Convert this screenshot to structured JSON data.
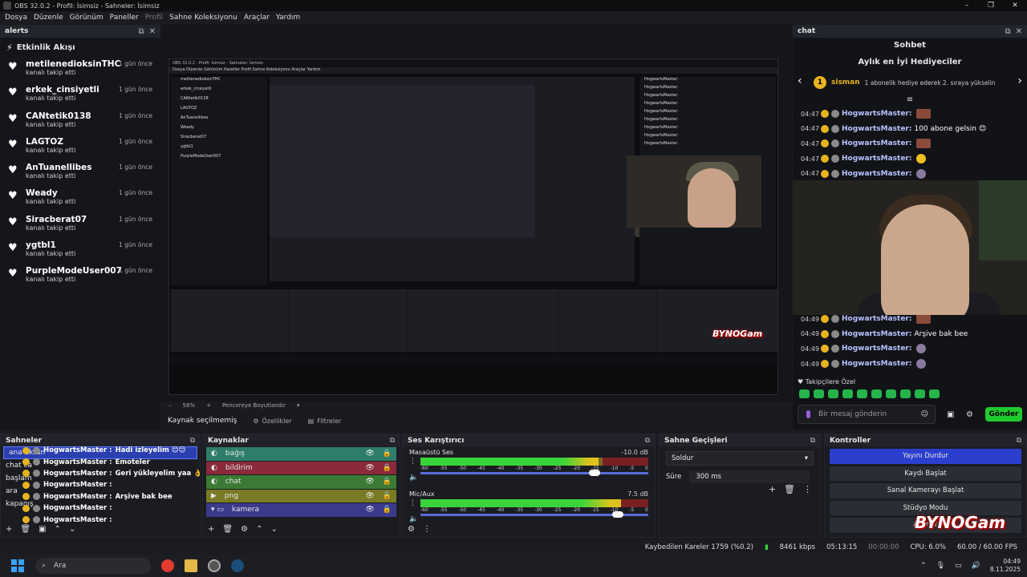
{
  "window": {
    "title": "OBS 32.0.2 - Profil: İsimsiz - Sahneler: İsimsiz",
    "controls": [
      "–",
      "❐",
      "✕"
    ]
  },
  "menu": [
    "Dosya",
    "Düzenle",
    "Görünüm",
    "Paneller",
    "Profil",
    "Sahne Koleksiyonu",
    "Araçlar",
    "Yardım"
  ],
  "alerts": {
    "dock_title": "alerts",
    "feed_title": "Etkinlik Akışı",
    "items": [
      {
        "name": "metilenedioksinTHC",
        "sub": "kanalı takip etti",
        "time": "1 gün önce"
      },
      {
        "name": "erkek_cinsiyetli",
        "sub": "kanalı takip etti",
        "time": "1 gün önce"
      },
      {
        "name": "CANtetik0138",
        "sub": "kanalı takip etti",
        "time": "1 gün önce"
      },
      {
        "name": "LAGTOZ",
        "sub": "kanalı takip etti",
        "time": "1 gün önce"
      },
      {
        "name": "AnTuanellibes",
        "sub": "kanalı takip etti",
        "time": "1 gün önce"
      },
      {
        "name": "Weady",
        "sub": "kanalı takip etti",
        "time": "1 gün önce"
      },
      {
        "name": "Siracberat07",
        "sub": "kanalı takip etti",
        "time": "1 gün önce"
      },
      {
        "name": "ygtbl1",
        "sub": "kanalı takip etti",
        "time": "1 gün önce"
      },
      {
        "name": "PurpleModeUser007",
        "sub": "kanalı takip etti",
        "time": "1 gün önce"
      }
    ]
  },
  "preview": {
    "inner_title": "OBS 32.0.2 - Profil: İsimsiz - Sahneler: İsimsiz",
    "inner_menu": "Dosya   Düzenle   Görünüm   Paneller   Profil   Sahne Koleksiyonu   Araçlar   Yardım",
    "zoom": "58%",
    "fit_label": "Pencereye Boyutlandır",
    "no_source": "Kaynak seçilmemiş",
    "properties": "Özellikler",
    "filters": "Filtreler"
  },
  "chat": {
    "dock_title": "chat",
    "title": "Sohbet",
    "gifters_title": "Aylık en İyi Hediyeciler",
    "top_gifter": {
      "rank": "1",
      "name": "sisman",
      "desc": "1 abonelik hediye ederek 2. sıraya yükselin"
    },
    "messages": [
      {
        "time": "04:47",
        "user": "HogwartsMaster:",
        "text": "",
        "emote": "face"
      },
      {
        "time": "04:47",
        "user": "HogwartsMaster:",
        "text": "100 abone gelsin 😊",
        "emote": ""
      },
      {
        "time": "04:47",
        "user": "HogwartsMaster:",
        "text": "",
        "emote": "face"
      },
      {
        "time": "04:47",
        "user": "HogwartsMaster:",
        "text": "",
        "emote": "chick"
      },
      {
        "time": "04:47",
        "user": "HogwartsMaster:",
        "text": "",
        "emote": "ghost"
      }
    ],
    "messages_after": [
      {
        "time": "04:49",
        "user": "HogwartsMaster:",
        "text": "",
        "emote": "face"
      },
      {
        "time": "04:49",
        "user": "HogwartsMaster:",
        "text": "Arşive bak bee",
        "emote": ""
      },
      {
        "time": "04:49",
        "user": "HogwartsMaster:",
        "text": "",
        "emote": "ghost"
      },
      {
        "time": "04:49",
        "user": "HogwartsMaster:",
        "text": "",
        "emote": "ghost"
      }
    ],
    "follower_label": "Takipçilere Özel",
    "input_placeholder": "Bir mesaj gönderin",
    "send_label": "Gönder"
  },
  "scenes": {
    "title": "Sahneler",
    "items": [
      "ana ekran",
      "chat ca",
      "başlam",
      "ara",
      "kapanış"
    ],
    "overlay": [
      {
        "user": "HogwartsMaster :",
        "text": "Hadi izleyelim 😊😊"
      },
      {
        "user": "HogwartsMaster :",
        "text": "Emoteler"
      },
      {
        "user": "HogwartsMaster :",
        "text": "Geri yükleyelim yaa 👌"
      },
      {
        "user": "HogwartsMaster :",
        "text": ""
      },
      {
        "user": "HogwartsMaster :",
        "text": "Arşive bak bee"
      },
      {
        "user": "HogwartsMaster :",
        "text": ""
      },
      {
        "user": "HogwartsMaster :",
        "text": ""
      }
    ]
  },
  "sources": {
    "title": "Kaynaklar",
    "items": [
      {
        "label": "bağış",
        "color": "#2e7d6a"
      },
      {
        "label": "bildirim",
        "color": "#8a2a3a"
      },
      {
        "label": "chat",
        "color": "#3a7a34"
      },
      {
        "label": "png",
        "color": "#7a7a26"
      },
      {
        "label": "kamera",
        "color": "#3b3a8a"
      }
    ]
  },
  "mixer": {
    "title": "Ses Karıştırıcı",
    "channels": [
      {
        "name": "Masaüstü Ses",
        "db": "-10.0 dB",
        "level": 0.78
      },
      {
        "name": "Mic/Aux",
        "db": "7.5 dB",
        "level": 0.88
      }
    ],
    "scale": [
      "-60",
      "-55",
      "-50",
      "-45",
      "-40",
      "-35",
      "-30",
      "-25",
      "-20",
      "-15",
      "-10",
      "-5",
      "0"
    ]
  },
  "transitions": {
    "title": "Sahne Geçişleri",
    "selected": "Soldur",
    "duration_label": "Süre",
    "duration": "300 ms"
  },
  "controls": {
    "title": "Kontroller",
    "buttons": [
      "Yayını Durdur",
      "Kaydı Başlat",
      "Sanal Kamerayı Başlat",
      "Stüdyo Modu",
      "Ayarlar"
    ]
  },
  "status": {
    "dropped": "Kaybedilen Kareler 1759 (%0.2)",
    "bitrate": "8461 kbps",
    "stream_time": "05:13:15",
    "rec_time": "00:00:00",
    "cpu": "CPU: 6.0%",
    "fps": "60.00 / 60.00 FPS"
  },
  "taskbar": {
    "search": "Ara",
    "time": "04:49",
    "date": "8.11.2025"
  },
  "watermark": "BYNOGam",
  "colors": {
    "accent": "#2b3fcf",
    "gold": "#e7b31e",
    "send": "#20c92e"
  }
}
